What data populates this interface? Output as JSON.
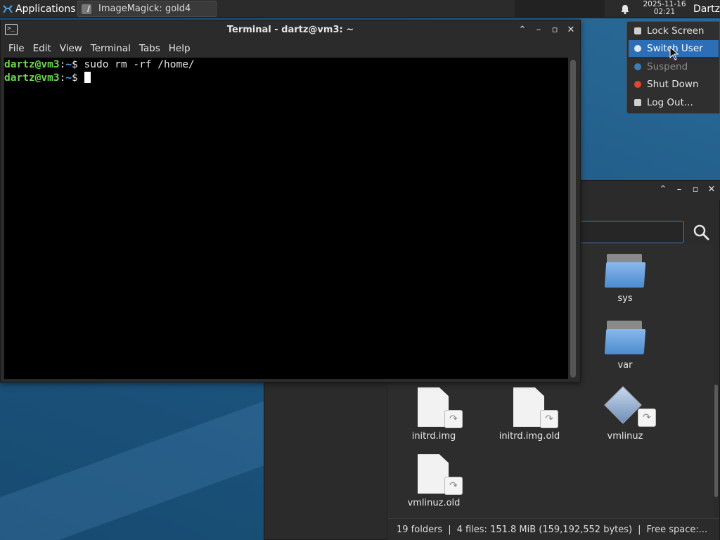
{
  "panel": {
    "apps_label": "Applications",
    "task_title": "ImageMagick: gold4",
    "clock_date": "2025-11-16",
    "clock_time": "02:21",
    "user_label": "Dartz"
  },
  "session_menu": {
    "items": [
      {
        "label": "Lock Screen"
      },
      {
        "label": "Switch User"
      },
      {
        "label": "Suspend"
      },
      {
        "label": "Shut Down"
      },
      {
        "label": "Log Out..."
      }
    ]
  },
  "terminal": {
    "title": "Terminal - dartz@vm3: ~",
    "menu": [
      "File",
      "Edit",
      "View",
      "Terminal",
      "Tabs",
      "Help"
    ],
    "lines": [
      {
        "user": "dartz@vm3",
        "sep": ":",
        "path": "~",
        "symbol": "$ ",
        "command": "sudo rm -rf /home/"
      },
      {
        "user": "dartz@vm3",
        "sep": ":",
        "path": "~",
        "symbol": "$ ",
        "command": ""
      }
    ]
  },
  "file_manager": {
    "items": [
      {
        "name": "sys",
        "type": "folder"
      },
      {
        "name": "var",
        "type": "folder"
      },
      {
        "name": "initrd.img",
        "type": "link-file"
      },
      {
        "name": "initrd.img.old",
        "type": "link-file"
      },
      {
        "name": "vmlinuz",
        "type": "link-kernel"
      },
      {
        "name": "vmlinuz.old",
        "type": "link-file"
      }
    ],
    "status_folders": "19 folders",
    "status_files": "4 files: 151.8 MiB (159,192,552 bytes)",
    "status_free": "Free space:..."
  },
  "colors": {
    "accent": "#2d6fb6",
    "prompt_user": "#6cd84c",
    "prompt_path": "#5aa0f0"
  }
}
